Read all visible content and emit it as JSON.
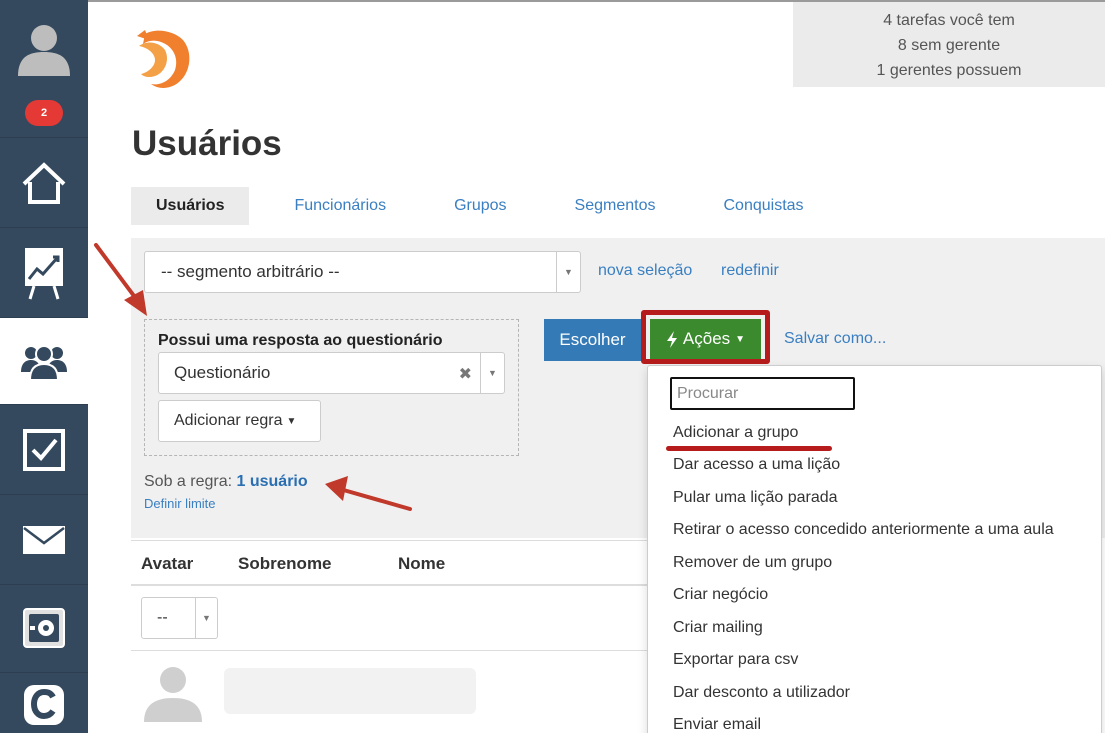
{
  "sidebar": {
    "badge": "2",
    "items": [
      {
        "name": "home",
        "icon": "home-icon"
      },
      {
        "name": "stats",
        "icon": "chart-board-icon"
      },
      {
        "name": "users",
        "icon": "users-icon"
      },
      {
        "name": "tasks",
        "icon": "checkbox-icon"
      },
      {
        "name": "mail",
        "icon": "mail-icon"
      },
      {
        "name": "safe",
        "icon": "safe-icon"
      },
      {
        "name": "c-app",
        "icon": "c-logo-icon"
      }
    ]
  },
  "stats": {
    "line1": "4 tarefas você tem",
    "line2": "8 sem gerente",
    "line3": "1 gerentes possuem"
  },
  "page_title": "Usuários",
  "tabs": [
    "Usuários",
    "Funcionários",
    "Grupos",
    "Segmentos",
    "Conquistas"
  ],
  "filter": {
    "segment_value": "-- segmento arbitrário --",
    "new_selection": "nova seleção",
    "reset": "redefinir",
    "rule_title": "Possui uma resposta ao questionário",
    "questionnaire_value": "Questionário",
    "add_rule": "Adicionar regra",
    "under_rule_prefix": "Sob a regra:",
    "under_rule_count": "1 usuário",
    "define_limit": "Definir limite"
  },
  "actions": {
    "choose": "Escolher",
    "actions": "Ações",
    "save_as": "Salvar como..."
  },
  "table": {
    "columns": [
      "Avatar",
      "Sobrenome",
      "Nome"
    ],
    "filter_value": "--"
  },
  "dropdown": {
    "search_placeholder": "Procurar",
    "items": [
      "Adicionar a grupo",
      "Dar acesso a uma lição",
      "Pular uma lição parada",
      "Retirar o acesso concedido anteriormente a uma aula",
      "Remover de um grupo",
      "Criar negócio",
      "Criar mailing",
      "Exportar para csv",
      "Dar desconto a utilizador",
      "Enviar email"
    ]
  },
  "colors": {
    "sidebar": "#34495e",
    "link": "#3a7fc1",
    "primary_button": "#337ab7",
    "actions_button": "#3c8a2e",
    "annotation_red": "#b71c1c",
    "badge_red": "#e53935"
  }
}
